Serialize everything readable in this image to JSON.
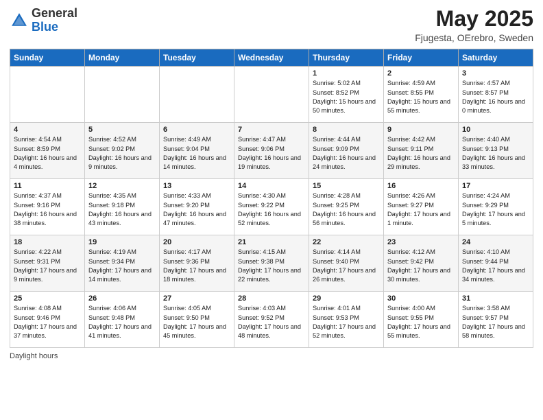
{
  "header": {
    "logo_general": "General",
    "logo_blue": "Blue",
    "month_year": "May 2025",
    "location": "Fjugesta, OErebro, Sweden"
  },
  "days_of_week": [
    "Sunday",
    "Monday",
    "Tuesday",
    "Wednesday",
    "Thursday",
    "Friday",
    "Saturday"
  ],
  "footer": {
    "daylight_hours": "Daylight hours"
  },
  "weeks": [
    [
      {
        "day": "",
        "sunrise": "",
        "sunset": "",
        "daylight": ""
      },
      {
        "day": "",
        "sunrise": "",
        "sunset": "",
        "daylight": ""
      },
      {
        "day": "",
        "sunrise": "",
        "sunset": "",
        "daylight": ""
      },
      {
        "day": "",
        "sunrise": "",
        "sunset": "",
        "daylight": ""
      },
      {
        "day": "1",
        "sunrise": "Sunrise: 5:02 AM",
        "sunset": "Sunset: 8:52 PM",
        "daylight": "Daylight: 15 hours and 50 minutes."
      },
      {
        "day": "2",
        "sunrise": "Sunrise: 4:59 AM",
        "sunset": "Sunset: 8:55 PM",
        "daylight": "Daylight: 15 hours and 55 minutes."
      },
      {
        "day": "3",
        "sunrise": "Sunrise: 4:57 AM",
        "sunset": "Sunset: 8:57 PM",
        "daylight": "Daylight: 16 hours and 0 minutes."
      }
    ],
    [
      {
        "day": "4",
        "sunrise": "Sunrise: 4:54 AM",
        "sunset": "Sunset: 8:59 PM",
        "daylight": "Daylight: 16 hours and 4 minutes."
      },
      {
        "day": "5",
        "sunrise": "Sunrise: 4:52 AM",
        "sunset": "Sunset: 9:02 PM",
        "daylight": "Daylight: 16 hours and 9 minutes."
      },
      {
        "day": "6",
        "sunrise": "Sunrise: 4:49 AM",
        "sunset": "Sunset: 9:04 PM",
        "daylight": "Daylight: 16 hours and 14 minutes."
      },
      {
        "day": "7",
        "sunrise": "Sunrise: 4:47 AM",
        "sunset": "Sunset: 9:06 PM",
        "daylight": "Daylight: 16 hours and 19 minutes."
      },
      {
        "day": "8",
        "sunrise": "Sunrise: 4:44 AM",
        "sunset": "Sunset: 9:09 PM",
        "daylight": "Daylight: 16 hours and 24 minutes."
      },
      {
        "day": "9",
        "sunrise": "Sunrise: 4:42 AM",
        "sunset": "Sunset: 9:11 PM",
        "daylight": "Daylight: 16 hours and 29 minutes."
      },
      {
        "day": "10",
        "sunrise": "Sunrise: 4:40 AM",
        "sunset": "Sunset: 9:13 PM",
        "daylight": "Daylight: 16 hours and 33 minutes."
      }
    ],
    [
      {
        "day": "11",
        "sunrise": "Sunrise: 4:37 AM",
        "sunset": "Sunset: 9:16 PM",
        "daylight": "Daylight: 16 hours and 38 minutes."
      },
      {
        "day": "12",
        "sunrise": "Sunrise: 4:35 AM",
        "sunset": "Sunset: 9:18 PM",
        "daylight": "Daylight: 16 hours and 43 minutes."
      },
      {
        "day": "13",
        "sunrise": "Sunrise: 4:33 AM",
        "sunset": "Sunset: 9:20 PM",
        "daylight": "Daylight: 16 hours and 47 minutes."
      },
      {
        "day": "14",
        "sunrise": "Sunrise: 4:30 AM",
        "sunset": "Sunset: 9:22 PM",
        "daylight": "Daylight: 16 hours and 52 minutes."
      },
      {
        "day": "15",
        "sunrise": "Sunrise: 4:28 AM",
        "sunset": "Sunset: 9:25 PM",
        "daylight": "Daylight: 16 hours and 56 minutes."
      },
      {
        "day": "16",
        "sunrise": "Sunrise: 4:26 AM",
        "sunset": "Sunset: 9:27 PM",
        "daylight": "Daylight: 17 hours and 1 minute."
      },
      {
        "day": "17",
        "sunrise": "Sunrise: 4:24 AM",
        "sunset": "Sunset: 9:29 PM",
        "daylight": "Daylight: 17 hours and 5 minutes."
      }
    ],
    [
      {
        "day": "18",
        "sunrise": "Sunrise: 4:22 AM",
        "sunset": "Sunset: 9:31 PM",
        "daylight": "Daylight: 17 hours and 9 minutes."
      },
      {
        "day": "19",
        "sunrise": "Sunrise: 4:19 AM",
        "sunset": "Sunset: 9:34 PM",
        "daylight": "Daylight: 17 hours and 14 minutes."
      },
      {
        "day": "20",
        "sunrise": "Sunrise: 4:17 AM",
        "sunset": "Sunset: 9:36 PM",
        "daylight": "Daylight: 17 hours and 18 minutes."
      },
      {
        "day": "21",
        "sunrise": "Sunrise: 4:15 AM",
        "sunset": "Sunset: 9:38 PM",
        "daylight": "Daylight: 17 hours and 22 minutes."
      },
      {
        "day": "22",
        "sunrise": "Sunrise: 4:14 AM",
        "sunset": "Sunset: 9:40 PM",
        "daylight": "Daylight: 17 hours and 26 minutes."
      },
      {
        "day": "23",
        "sunrise": "Sunrise: 4:12 AM",
        "sunset": "Sunset: 9:42 PM",
        "daylight": "Daylight: 17 hours and 30 minutes."
      },
      {
        "day": "24",
        "sunrise": "Sunrise: 4:10 AM",
        "sunset": "Sunset: 9:44 PM",
        "daylight": "Daylight: 17 hours and 34 minutes."
      }
    ],
    [
      {
        "day": "25",
        "sunrise": "Sunrise: 4:08 AM",
        "sunset": "Sunset: 9:46 PM",
        "daylight": "Daylight: 17 hours and 37 minutes."
      },
      {
        "day": "26",
        "sunrise": "Sunrise: 4:06 AM",
        "sunset": "Sunset: 9:48 PM",
        "daylight": "Daylight: 17 hours and 41 minutes."
      },
      {
        "day": "27",
        "sunrise": "Sunrise: 4:05 AM",
        "sunset": "Sunset: 9:50 PM",
        "daylight": "Daylight: 17 hours and 45 minutes."
      },
      {
        "day": "28",
        "sunrise": "Sunrise: 4:03 AM",
        "sunset": "Sunset: 9:52 PM",
        "daylight": "Daylight: 17 hours and 48 minutes."
      },
      {
        "day": "29",
        "sunrise": "Sunrise: 4:01 AM",
        "sunset": "Sunset: 9:53 PM",
        "daylight": "Daylight: 17 hours and 52 minutes."
      },
      {
        "day": "30",
        "sunrise": "Sunrise: 4:00 AM",
        "sunset": "Sunset: 9:55 PM",
        "daylight": "Daylight: 17 hours and 55 minutes."
      },
      {
        "day": "31",
        "sunrise": "Sunrise: 3:58 AM",
        "sunset": "Sunset: 9:57 PM",
        "daylight": "Daylight: 17 hours and 58 minutes."
      }
    ]
  ]
}
